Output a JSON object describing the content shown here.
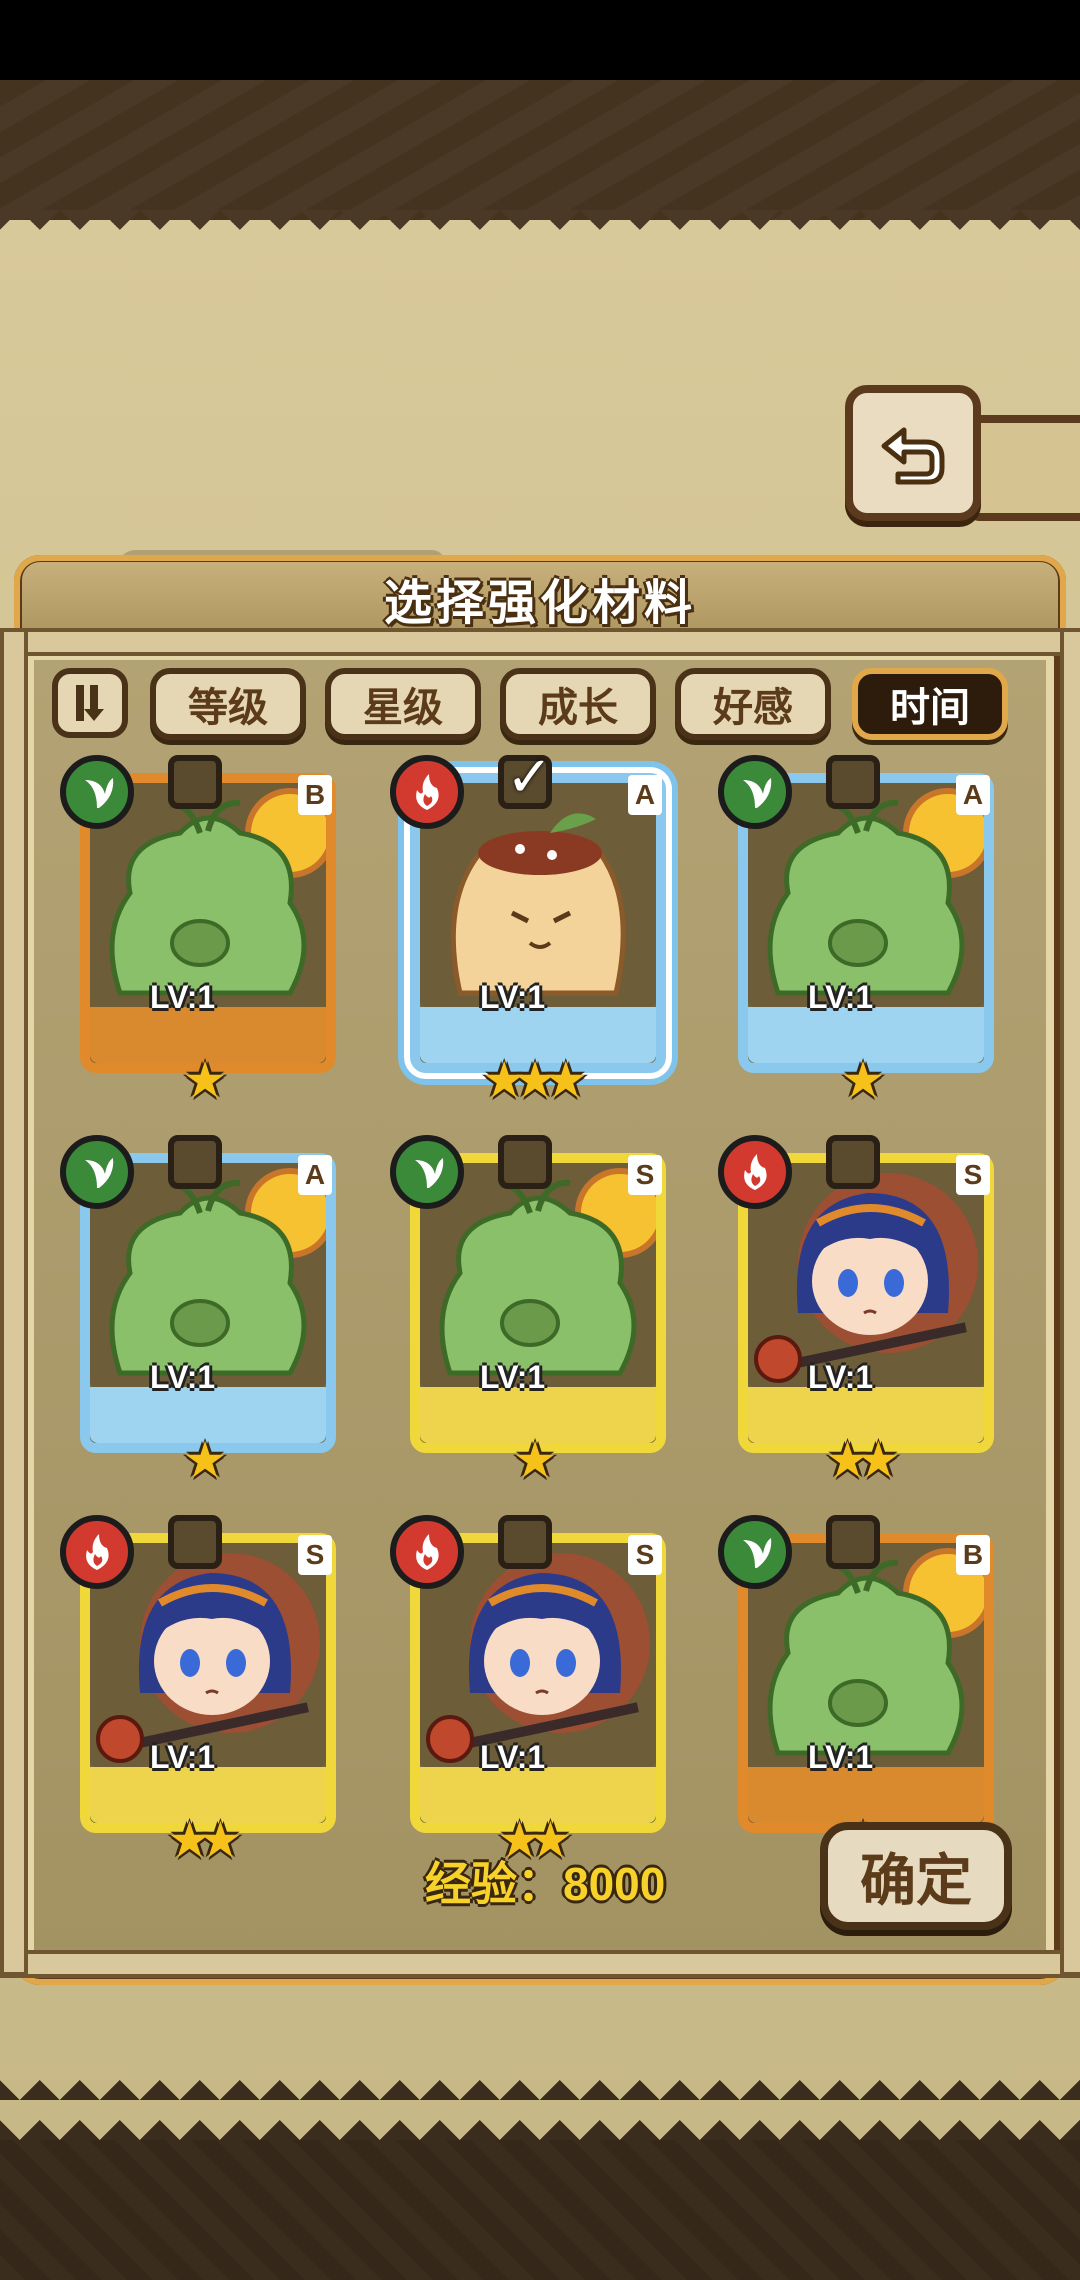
{
  "panel": {
    "title": "选择强化材料"
  },
  "filters": {
    "sort_toggle_icon": "sort-order-icon",
    "tabs": [
      "等级",
      "星级",
      "成长",
      "好感",
      "时间"
    ],
    "active_tab": "时间"
  },
  "cards": [
    {
      "element": "grass",
      "rank": "B",
      "level": "LV:1",
      "stars": 1,
      "checked": false,
      "creature": "green-slime"
    },
    {
      "element": "fire",
      "rank": "A",
      "level": "LV:1",
      "stars": 3,
      "checked": true,
      "creature": "pudding"
    },
    {
      "element": "grass",
      "rank": "A",
      "level": "LV:1",
      "stars": 1,
      "checked": false,
      "creature": "green-slime"
    },
    {
      "element": "grass",
      "rank": "A",
      "level": "LV:1",
      "stars": 1,
      "checked": false,
      "creature": "green-slime"
    },
    {
      "element": "grass",
      "rank": "S",
      "level": "LV:1",
      "stars": 1,
      "checked": false,
      "creature": "green-slime"
    },
    {
      "element": "fire",
      "rank": "S",
      "level": "LV:1",
      "stars": 2,
      "checked": false,
      "creature": "blue-hair-girl"
    },
    {
      "element": "fire",
      "rank": "S",
      "level": "LV:1",
      "stars": 2,
      "checked": false,
      "creature": "blue-hair-girl"
    },
    {
      "element": "fire",
      "rank": "S",
      "level": "LV:1",
      "stars": 2,
      "checked": false,
      "creature": "blue-hair-girl"
    },
    {
      "element": "grass",
      "rank": "B",
      "level": "LV:1",
      "stars": 1,
      "checked": false,
      "creature": "green-slime"
    }
  ],
  "footer": {
    "exp_text": "经验：8000",
    "confirm_label": "确定"
  },
  "colors": {
    "rank_B": "#e08a2c",
    "rank_A": "#8ac8ee",
    "rank_S": "#f1d83a",
    "grass": "#3a8a3a",
    "fire": "#d33a2f"
  }
}
